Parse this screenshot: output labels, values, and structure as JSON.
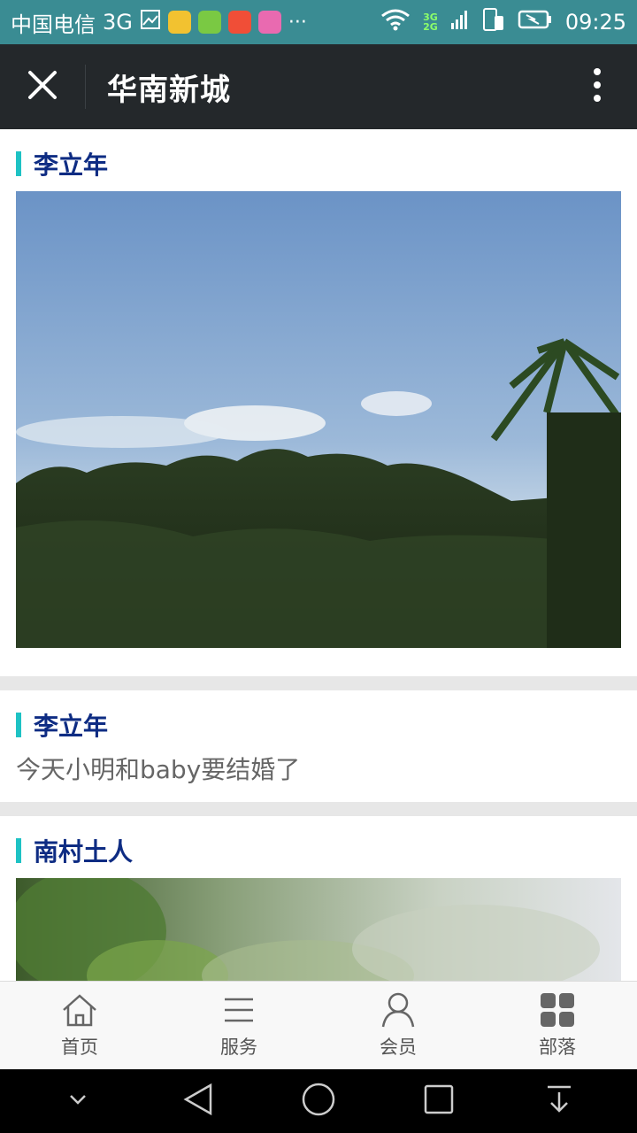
{
  "status_bar": {
    "carrier": "中国电信",
    "network": "3G",
    "overflow": "···",
    "net_3g": "3G",
    "net_2g": "2G",
    "time": "09:25"
  },
  "title_bar": {
    "title": "华南新城"
  },
  "feed": {
    "posts": [
      {
        "author": "李立年"
      },
      {
        "author": "李立年",
        "text": "今天小明和baby要结婚了"
      },
      {
        "author": "南村土人"
      }
    ]
  },
  "tab_bar": {
    "tabs": [
      {
        "label": "首页",
        "icon": "home-icon"
      },
      {
        "label": "服务",
        "icon": "list-icon"
      },
      {
        "label": "会员",
        "icon": "user-icon"
      },
      {
        "label": "部落",
        "icon": "grid-icon"
      }
    ]
  },
  "colors": {
    "status_bar": "#3a8c93",
    "title_bar": "#24282b",
    "accent": "#1ec2c4",
    "author": "#0e2c83"
  }
}
